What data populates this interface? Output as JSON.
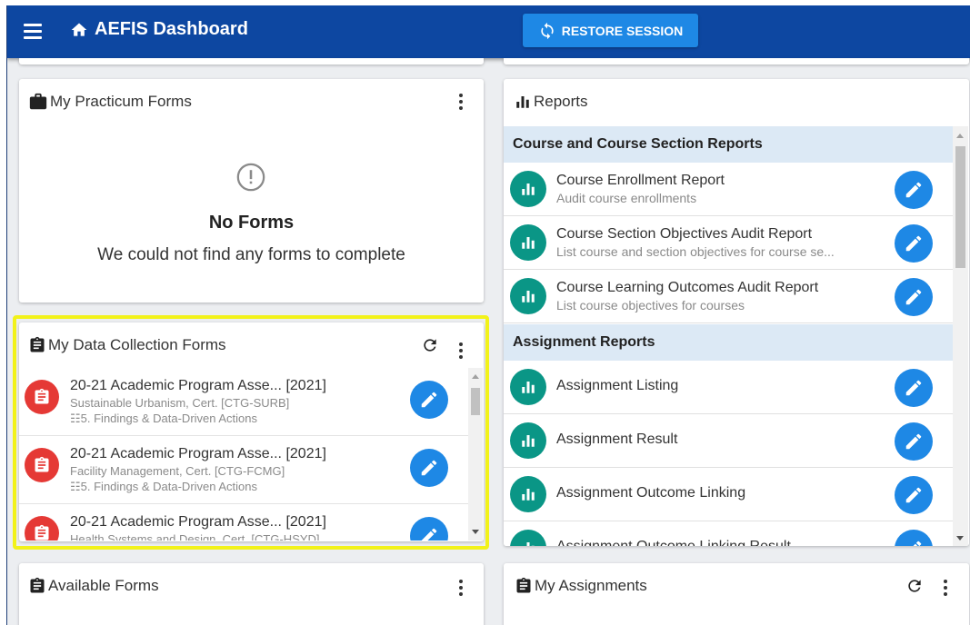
{
  "app": {
    "title": "AEFIS Dashboard",
    "restore_label": "RESTORE SESSION"
  },
  "practicum": {
    "title": "My Practicum Forms",
    "empty_title": "No Forms",
    "empty_message": "We could not find any forms to complete"
  },
  "data_collection": {
    "title": "My Data Collection Forms",
    "items": [
      {
        "title": "20-21 Academic Program Asse... [2021]",
        "program": "Sustainable Urbanism, Cert. [CTG-SURB]",
        "stage": "5. Findings & Data-Driven Actions"
      },
      {
        "title": "20-21 Academic Program Asse... [2021]",
        "program": "Facility Management, Cert. [CTG-FCMG]",
        "stage": "5. Findings & Data-Driven Actions"
      },
      {
        "title": "20-21 Academic Program Asse... [2021]",
        "program": "Health Systems and Design, Cert. [CTG-HSYD]",
        "stage": ""
      }
    ]
  },
  "available": {
    "title": "Available Forms"
  },
  "reports": {
    "title": "Reports",
    "sections": [
      {
        "label": "Course and Course Section Reports",
        "items": [
          {
            "title": "Course Enrollment Report",
            "subtitle": "Audit course enrollments"
          },
          {
            "title": "Course Section Objectives Audit Report",
            "subtitle": "List course and section objectives for course se..."
          },
          {
            "title": "Course Learning Outcomes Audit Report",
            "subtitle": "List course objectives for courses"
          }
        ]
      },
      {
        "label": "Assignment Reports",
        "items": [
          {
            "title": "Assignment Listing",
            "subtitle": ""
          },
          {
            "title": "Assignment Result",
            "subtitle": ""
          },
          {
            "title": "Assignment Outcome Linking",
            "subtitle": ""
          },
          {
            "title": "Assignment Outcome Linking Result",
            "subtitle": ""
          }
        ]
      }
    ]
  },
  "assignments": {
    "title": "My Assignments"
  },
  "colors": {
    "appbar": "#0d47a1",
    "restore_button": "#1e88e5",
    "form_avatar": "#e53935",
    "report_avatar": "#0a9686",
    "edit_button": "#1e88e5",
    "section_header": "#dce9f5",
    "highlight": "#f2f21a"
  },
  "icons": {
    "menu": "hamburger-icon",
    "home": "home-icon",
    "restore": "sync-icon",
    "forms": "clipboard-icon",
    "practicum": "briefcase-icon",
    "reports": "bar-chart-icon",
    "empty": "alert-circle-icon",
    "edit": "pencil-icon",
    "refresh": "refresh-icon",
    "more": "more-vert-icon",
    "stage": "list-icon"
  }
}
